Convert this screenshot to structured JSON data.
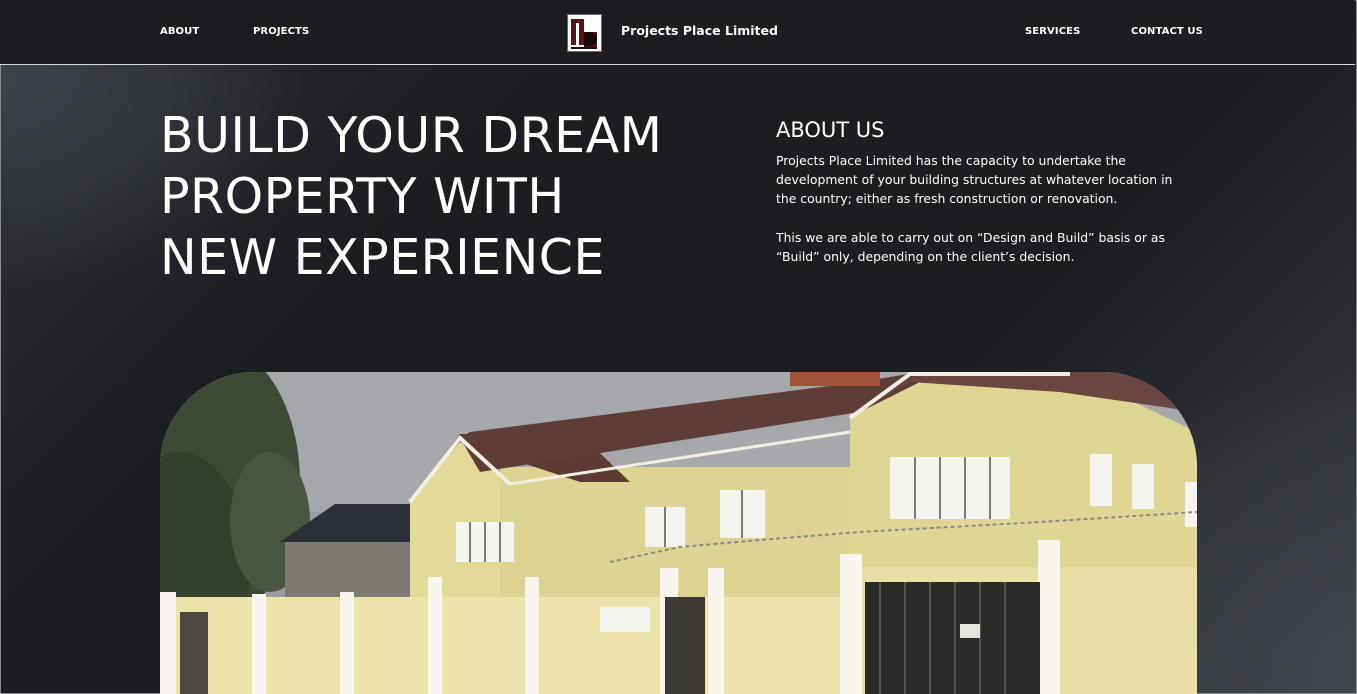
{
  "nav": {
    "left_links": [
      "ABOUT",
      "PROJECTS"
    ],
    "right_links": [
      "SERVICES",
      "CONTACT US"
    ],
    "brand_name": "Projects Place Limited",
    "logo_icon": "pp-monogram-logo"
  },
  "hero": {
    "title_lines": [
      "BUILD YOUR DREAM",
      "PROPERTY WITH",
      "NEW EXPERIENCE"
    ]
  },
  "about": {
    "heading": "ABOUT US",
    "paragraphs": [
      "Projects Place Limited has the capacity to undertake the development of your building structures at whatever location in the country; either as fresh construction or renovation.",
      "This we are able to carry out on “Design and Build” basis or as “Build” only, depending on the client’s decision."
    ]
  },
  "photo": {
    "subject": "house-photo"
  },
  "colors": {
    "background": "#1b1d21",
    "text": "#ffffff",
    "logo_maroon": "#5a1414"
  }
}
